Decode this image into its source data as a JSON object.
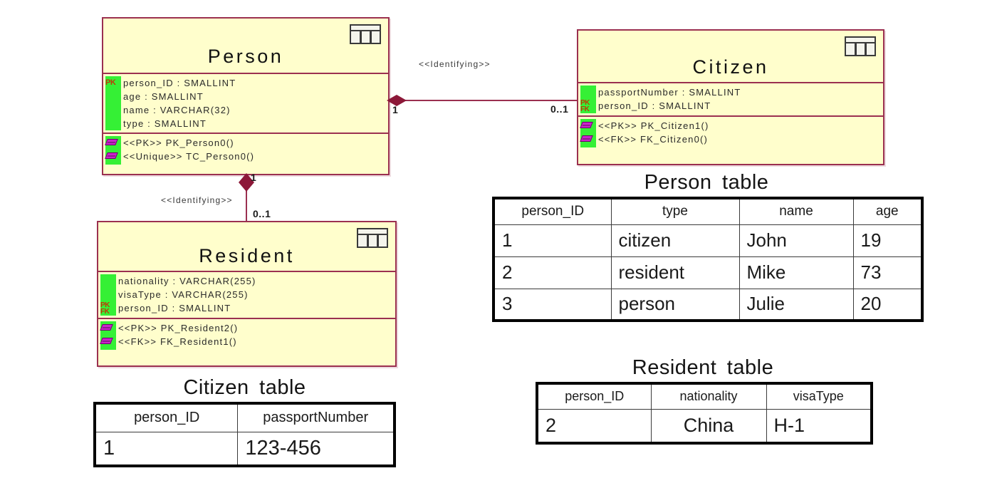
{
  "diagram": {
    "classes": [
      {
        "id": "person",
        "name": "Person",
        "icon": "table-icon",
        "attributes": [
          {
            "marker": "PK",
            "text": "person_ID : SMALLINT"
          },
          {
            "marker": "",
            "text": "age : SMALLINT"
          },
          {
            "marker": "",
            "text": "name : VARCHAR(32)"
          },
          {
            "marker": "",
            "text": "type : SMALLINT"
          }
        ],
        "operations": [
          {
            "icon": "operation-icon",
            "text": "<<PK>> PK_Person0()"
          },
          {
            "icon": "operation-icon",
            "text": "<<Unique>> TC_Person0()"
          }
        ]
      },
      {
        "id": "citizen",
        "name": "Citizen",
        "icon": "table-icon",
        "attributes": [
          {
            "marker": "",
            "text": "passportNumber : SMALLINT"
          },
          {
            "marker": "PK_FK",
            "text": "person_ID : SMALLINT"
          }
        ],
        "operations": [
          {
            "icon": "operation-icon",
            "text": "<<PK>> PK_Citizen1()"
          },
          {
            "icon": "operation-icon",
            "text": "<<FK>> FK_Citizen0()"
          }
        ]
      },
      {
        "id": "resident",
        "name": "Resident",
        "icon": "table-icon",
        "attributes": [
          {
            "marker": "",
            "text": "nationality : VARCHAR(255)"
          },
          {
            "marker": "",
            "text": "visaType : VARCHAR(255)"
          },
          {
            "marker": "PK_FK",
            "text": "person_ID : SMALLINT"
          }
        ],
        "operations": [
          {
            "icon": "operation-icon",
            "text": "<<PK>> PK_Resident2()"
          },
          {
            "icon": "operation-icon",
            "text": "<<FK>> FK_Resident1()"
          }
        ]
      }
    ],
    "relationships": [
      {
        "id": "person-citizen",
        "stereotype": "<<Identifying>>",
        "source_multiplicity": "1",
        "target_multiplicity": "0..1"
      },
      {
        "id": "person-resident",
        "stereotype": "<<Identifying>>",
        "source_multiplicity": "1",
        "target_multiplicity": "0..1"
      }
    ],
    "markers": {
      "pk": "PK",
      "fk": "FK"
    },
    "colors": {
      "class_fill": "#FFFECC",
      "class_border": "#9B3050",
      "key_highlight": "#35F035",
      "marker_text": "#C03808",
      "operation_icon": "#CC22CC",
      "connector": "#9B3050",
      "table_border": "#000000"
    }
  },
  "tables": {
    "person": {
      "caption": "Person  table",
      "columns": [
        "person_ID",
        "type",
        "name",
        "age"
      ],
      "rows": [
        [
          "1",
          "citizen",
          "John",
          "19"
        ],
        [
          "2",
          "resident",
          "Mike",
          "73"
        ],
        [
          "3",
          "person",
          "Julie",
          "20"
        ]
      ]
    },
    "citizen": {
      "caption": "Citizen  table",
      "columns": [
        "person_ID",
        "passportNumber"
      ],
      "rows": [
        [
          "1",
          "123-456"
        ]
      ]
    },
    "resident": {
      "caption": "Resident  table",
      "columns": [
        "person_ID",
        "nationality",
        "visaType"
      ],
      "rows": [
        [
          "2",
          "China",
          "H-1"
        ]
      ]
    }
  }
}
